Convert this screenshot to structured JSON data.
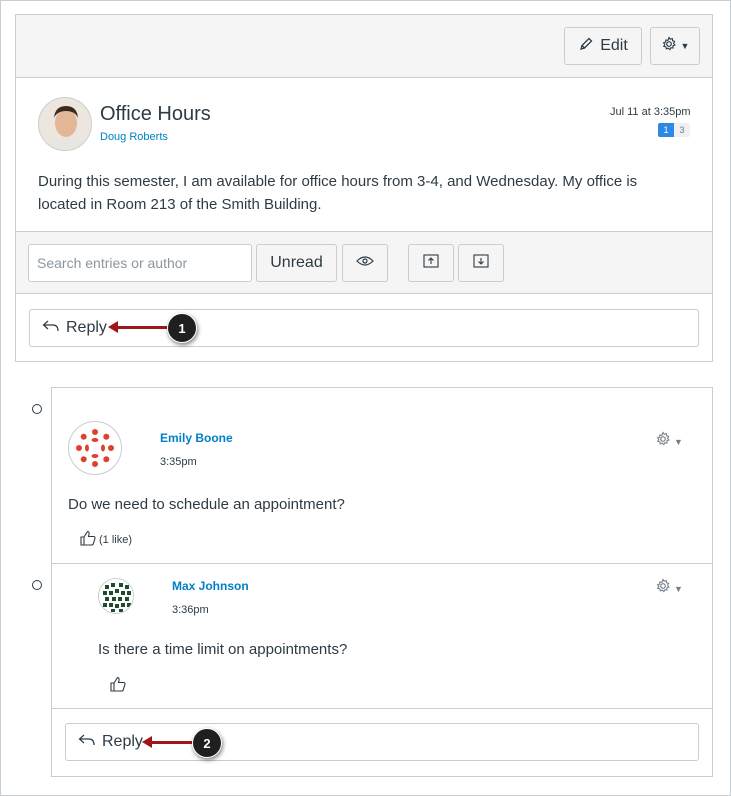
{
  "toolbar": {
    "edit_label": "Edit"
  },
  "topic": {
    "title": "Office Hours",
    "author": "Doug Roberts",
    "date": "Jul 11 at 3:35pm",
    "unread_count": "1",
    "total_count": "3",
    "body": "During this semester, I am available for office hours from 3-4, and Wednesday. My office is located in Room 213 of the Smith Building."
  },
  "filters": {
    "search_placeholder": "Search entries or author",
    "unread_label": "Unread"
  },
  "reply": {
    "label": "Reply"
  },
  "callouts": {
    "one": "1",
    "two": "2"
  },
  "entries": [
    {
      "author": "Emily Boone",
      "time": "3:35pm",
      "message": "Do we need to schedule an appointment?",
      "likes": "(1 like)"
    },
    {
      "author": "Max Johnson",
      "time": "3:36pm",
      "message": "Is there a time limit on appointments?",
      "likes": ""
    }
  ],
  "colors": {
    "link": "#0081c6",
    "callout_arrow": "#a0151a",
    "badge": "#2d89e5"
  },
  "icons": [
    "pencil-icon",
    "gear-icon",
    "eye-icon",
    "upload-icon",
    "download-icon",
    "reply-arrow-icon",
    "thumbs-up-icon"
  ]
}
